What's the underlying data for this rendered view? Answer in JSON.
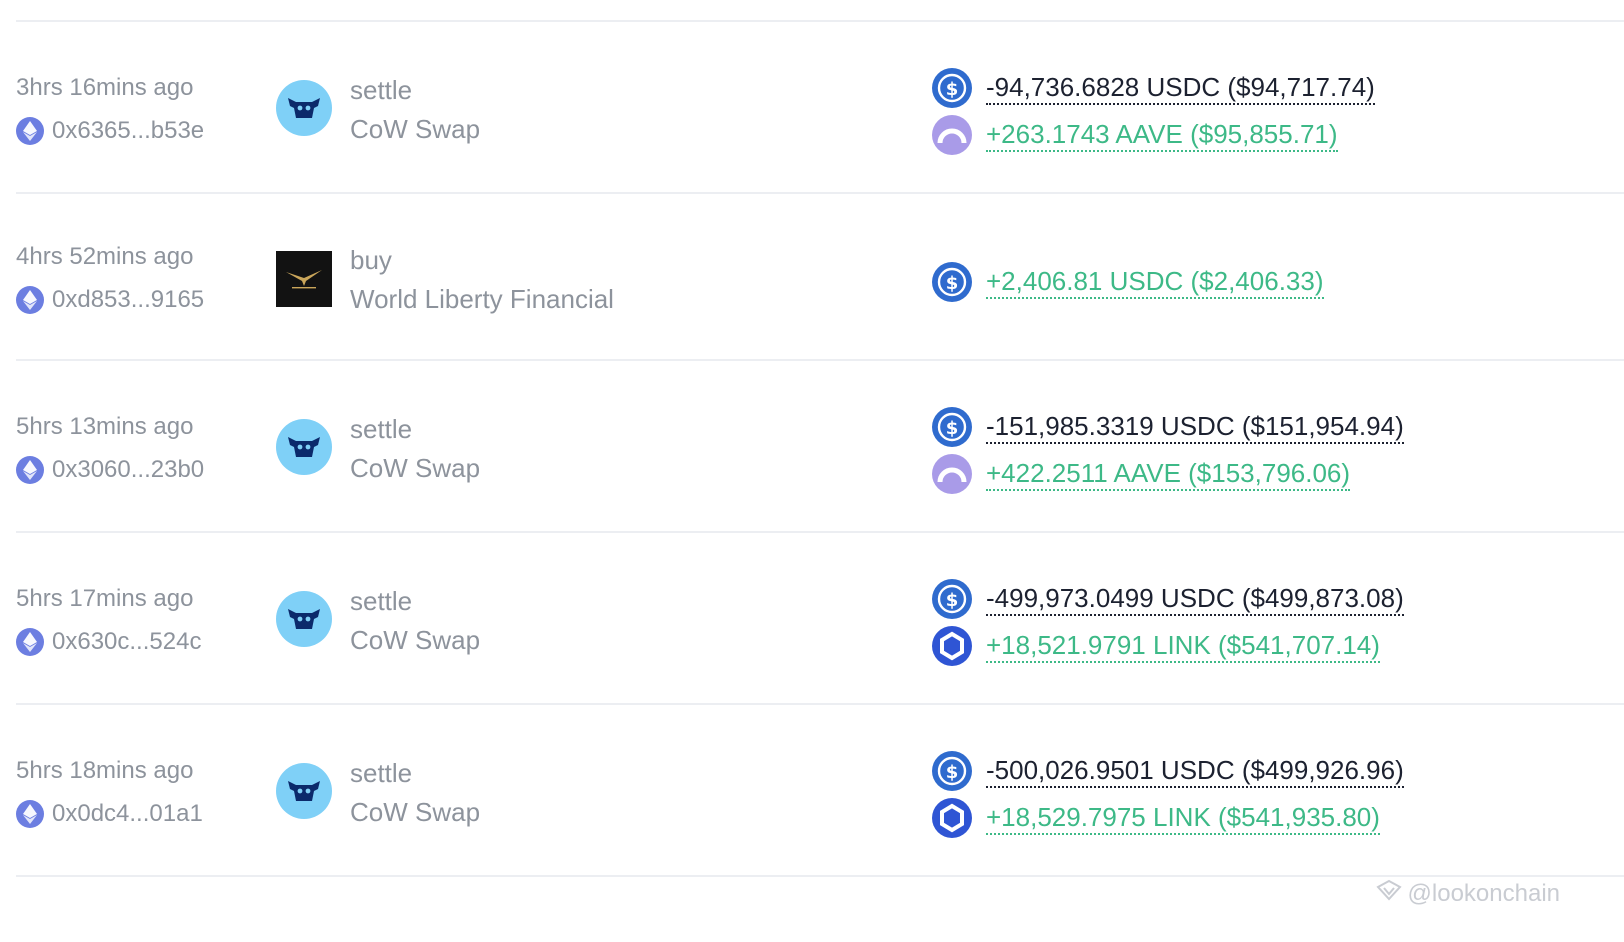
{
  "transactions": [
    {
      "time": "3hrs 16mins ago",
      "hash": "0x6365...b53e",
      "method": "settle",
      "protocol": "CoW Swap",
      "protocol_logo": "cow-swap-logo",
      "tokens": [
        {
          "icon": "usdc-icon",
          "amount": "-94,736.6828 USDC ($94,717.74)",
          "direction": "out"
        },
        {
          "icon": "aave-icon",
          "amount": "+263.1743 AAVE ($95,855.71)",
          "direction": "in"
        }
      ]
    },
    {
      "time": "4hrs 52mins ago",
      "hash": "0xd853...9165",
      "method": "buy",
      "protocol": "World Liberty Financial",
      "protocol_logo": "world-liberty-financial-logo",
      "tokens": [
        {
          "icon": "usdc-icon",
          "amount": "+2,406.81 USDC ($2,406.33)",
          "direction": "in"
        }
      ]
    },
    {
      "time": "5hrs 13mins ago",
      "hash": "0x3060...23b0",
      "method": "settle",
      "protocol": "CoW Swap",
      "protocol_logo": "cow-swap-logo",
      "tokens": [
        {
          "icon": "usdc-icon",
          "amount": "-151,985.3319 USDC ($151,954.94)",
          "direction": "out"
        },
        {
          "icon": "aave-icon",
          "amount": "+422.2511 AAVE ($153,796.06)",
          "direction": "in"
        }
      ]
    },
    {
      "time": "5hrs 17mins ago",
      "hash": "0x630c...524c",
      "method": "settle",
      "protocol": "CoW Swap",
      "protocol_logo": "cow-swap-logo",
      "tokens": [
        {
          "icon": "usdc-icon",
          "amount": "-499,973.0499 USDC ($499,873.08)",
          "direction": "out"
        },
        {
          "icon": "link-icon",
          "amount": "+18,521.9791 LINK ($541,707.14)",
          "direction": "in"
        }
      ]
    },
    {
      "time": "5hrs 18mins ago",
      "hash": "0x0dc4...01a1",
      "method": "settle",
      "protocol": "CoW Swap",
      "protocol_logo": "cow-swap-logo",
      "tokens": [
        {
          "icon": "usdc-icon",
          "amount": "-500,026.9501 USDC ($499,926.96)",
          "direction": "out"
        },
        {
          "icon": "link-icon",
          "amount": "+18,529.7975 LINK ($541,935.80)",
          "direction": "in"
        }
      ]
    }
  ],
  "watermark": "@lookonchain",
  "colors": {
    "negative": "#1c2130",
    "positive": "#3db987",
    "muted": "#8d939c",
    "usdc": "#2f6bce",
    "aave": "#a99be8",
    "link": "#2f55d4",
    "cow": "#7fd0f7"
  }
}
